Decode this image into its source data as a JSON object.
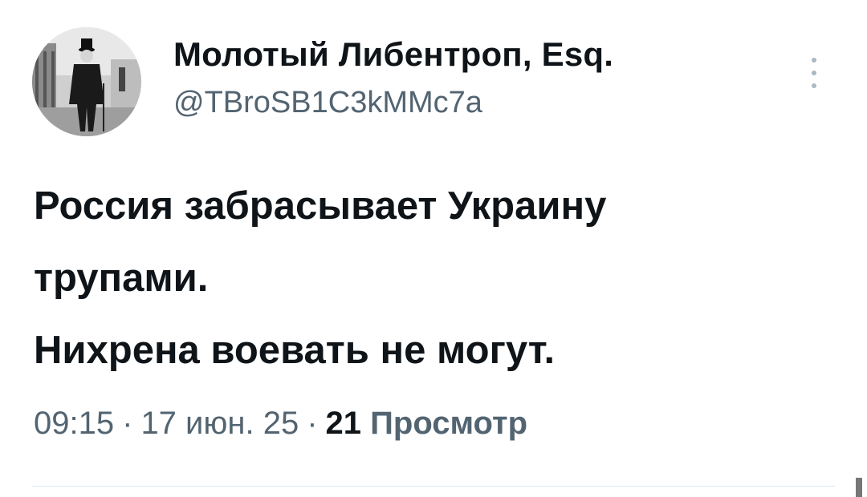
{
  "author": {
    "name": "Молотый Либентроп, Esq.",
    "handle": "@TBroSB1C3kMMc7a",
    "avatar_description_icon": "avatar-photo"
  },
  "tweet": {
    "lines": [
      "Россия забрасывает Украину",
      "трупами.",
      "Нихрена воевать не могут."
    ]
  },
  "meta": {
    "time": "09:15",
    "separator": "·",
    "date": "17 июн. 25",
    "views_count": "21",
    "views_label": "Просмотр"
  },
  "icons": {
    "more": "more-vertical-icon"
  },
  "colors": {
    "text_primary": "#0f1419",
    "text_secondary": "#536471",
    "divider": "#e1e8ed"
  }
}
